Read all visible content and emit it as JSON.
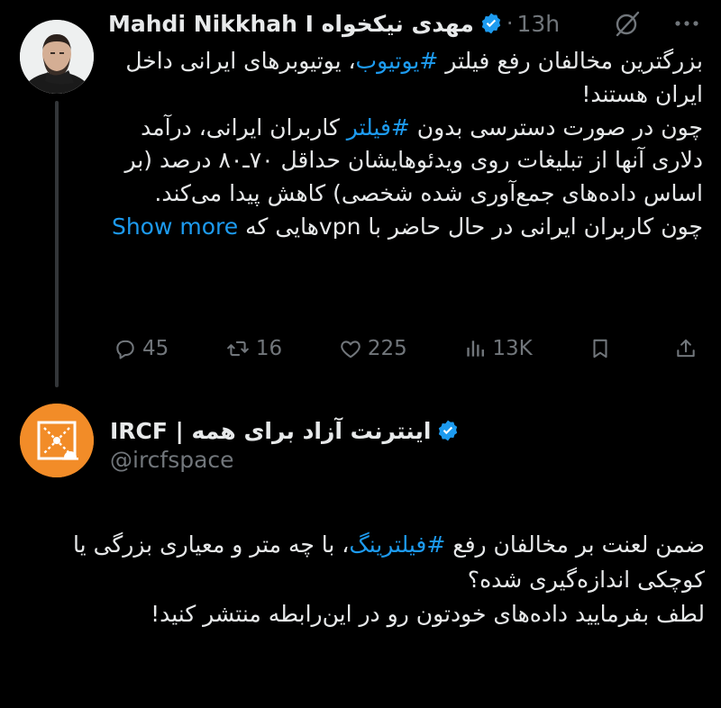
{
  "tweet1": {
    "author_name": "Mahdi Nikkhah I مهدی نیکخواه",
    "separator": "·",
    "time": "13h",
    "body": {
      "seg1": "بزرگترین مخالفان رفع فیلتر ",
      "hashtag1": "#یوتیوب",
      "seg2": "، یوتیوبرهای ایرانی داخل ایران هستند!",
      "seg3": "چون در صورت دسترسی بدون ",
      "hashtag2": "#فیلتر",
      "seg4": " کاربران ایرانی، درآمد دلاری آنها از تبلیغات روی ویدئوهایشان حداقل ۷۰ـ۸۰ درصد (بر اساس داده‌های جمع‌آوری شده شخصی) کاهش پیدا می‌کند.",
      "seg5": "چون کاربران ایرانی در حال حاضر با vpnهایی که ",
      "show_more": "Show more"
    },
    "actions": {
      "replies": "45",
      "retweets": "16",
      "likes": "225",
      "views": "13K"
    },
    "icons": [
      "verified-badge-icon",
      "grok-icon",
      "more-icon",
      "reply-icon",
      "retweet-icon",
      "like-icon",
      "views-icon",
      "bookmark-icon",
      "share-icon"
    ]
  },
  "tweet2": {
    "author_name": "IRCF | اینترنت آزاد برای همه",
    "handle": "@ircfspace",
    "body": {
      "seg1": "ضمن لعنت بر مخالفان رفع ",
      "hashtag1": "#فیلترینگ",
      "seg2": "، با چه متر و معیاری بزرگی یا کوچکی اندازه‌گیری شده؟",
      "seg3": "لطف بفرمایید داده‌های خودتون رو در این‌رابطه منتشر کنید!"
    }
  },
  "colors": {
    "background": "#000000",
    "text": "#e7e9ea",
    "muted": "#71767b",
    "accent": "#1d9bf0",
    "ircf_orange": "#f28c28"
  }
}
